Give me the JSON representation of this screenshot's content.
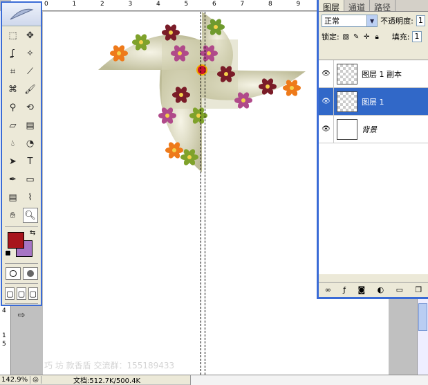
{
  "canvas": {
    "top_ruler_ticks": [
      "0",
      "1",
      "2",
      "3",
      "4",
      "5",
      "6",
      "7",
      "8",
      "9"
    ],
    "left_ruler_ticks": [
      "1",
      "4",
      "1",
      "5"
    ],
    "watermark": "巧 坊 款香盾   交流群：155189433"
  },
  "toolbox": {
    "tools": [
      [
        "marquee-icon",
        "move-icon"
      ],
      [
        "lasso-icon",
        "magic-wand-icon"
      ],
      [
        "crop-icon",
        "slice-icon"
      ],
      [
        "healing-brush-icon",
        "brush-icon"
      ],
      [
        "clone-stamp-icon",
        "history-brush-icon"
      ],
      [
        "eraser-icon",
        "gradient-icon"
      ],
      [
        "blur-icon",
        "dodge-icon"
      ],
      [
        "path-select-icon",
        "type-icon"
      ],
      [
        "pen-icon",
        "rectangle-icon"
      ],
      [
        "notes-icon",
        "eyedropper-icon"
      ],
      [
        "hand-icon",
        "zoom-icon"
      ]
    ],
    "type_glyph": "T",
    "foreground_color": "#a8141c",
    "background_color": "#a675c4"
  },
  "layers_panel": {
    "tabs": [
      "图层",
      "通道",
      "路径"
    ],
    "blend_mode": "正常",
    "opacity_label": "不透明度:",
    "opacity_value": "1",
    "lock_label": "锁定:",
    "fill_label": "填充:",
    "fill_value": "1",
    "layers": [
      {
        "name": "图层 1 副本",
        "selected": false,
        "thumb": "pinwheel",
        "italic": false
      },
      {
        "name": "图层 1",
        "selected": true,
        "thumb": "transparent",
        "italic": false
      },
      {
        "name": "背景",
        "selected": false,
        "thumb": "white",
        "italic": true
      }
    ]
  },
  "status": {
    "zoom": "142.9%",
    "doc_info": "文档:512.7K/500.4K"
  }
}
